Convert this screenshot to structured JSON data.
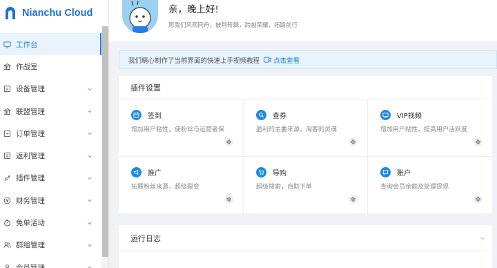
{
  "brand": {
    "name": "Nianchu Cloud",
    "accent": "#1e7fd9"
  },
  "sidebar": {
    "items": [
      {
        "label": "工作台",
        "icon": "monitor-icon",
        "active": true,
        "expandable": false
      },
      {
        "label": "作战室",
        "icon": "bank-icon",
        "active": false,
        "expandable": false
      },
      {
        "label": "设备管理",
        "icon": "device-icon",
        "active": false,
        "expandable": true
      },
      {
        "label": "联盟管理",
        "icon": "bank-icon",
        "active": false,
        "expandable": true
      },
      {
        "label": "订单管理",
        "icon": "order-icon",
        "active": false,
        "expandable": true
      },
      {
        "label": "返利管理",
        "icon": "rebate-icon",
        "active": false,
        "expandable": true
      },
      {
        "label": "插件管理",
        "icon": "link-icon",
        "active": false,
        "expandable": true
      },
      {
        "label": "财务管理",
        "icon": "yen-icon",
        "active": false,
        "expandable": true
      },
      {
        "label": "免单活动",
        "icon": "timer-icon",
        "active": false,
        "expandable": true
      },
      {
        "label": "群组管理",
        "icon": "group-icon",
        "active": false,
        "expandable": true
      },
      {
        "label": "会员管理",
        "icon": "member-icon",
        "active": false,
        "expandable": true
      }
    ]
  },
  "header": {
    "greeting": "亲，晚上好!",
    "motto": "愿我们风雨同舟，披荆斩棘，跨越荣耀，拓路前行"
  },
  "notice": {
    "text": "我们精心制作了当前界面的快速上手视频教程",
    "link_label": "点击查看"
  },
  "plugins": {
    "title": "插件设置",
    "items": [
      {
        "title": "签到",
        "desc": "增加用户粘性，使粉丝与运营者保",
        "icon": "calendar-icon"
      },
      {
        "title": "查券",
        "desc": "盈利的主要来源，淘客的灵魂",
        "icon": "search-icon"
      },
      {
        "title": "VIP视频",
        "desc": "增加用户粘性，提高用户活跃度",
        "icon": "tv-icon"
      },
      {
        "title": "推广",
        "desc": "拓展粉丝来源，超级裂变",
        "icon": "megaphone-icon"
      },
      {
        "title": "导购",
        "desc": "超级搜索，自助下单",
        "icon": "cart-icon"
      },
      {
        "title": "账户",
        "desc": "查询会员余额及处理提现",
        "icon": "chat-icon"
      }
    ]
  },
  "log": {
    "title": "运行日志"
  }
}
